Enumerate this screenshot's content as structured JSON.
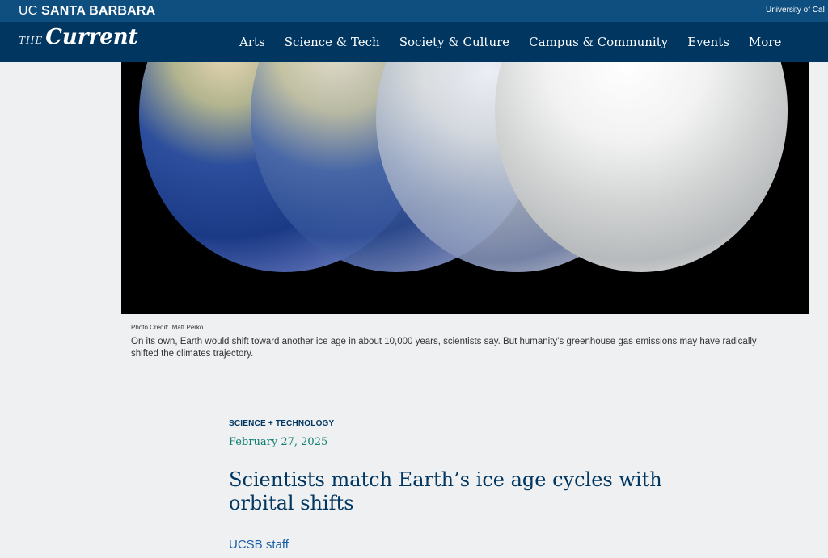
{
  "topbar": {
    "logo_uc": "UC",
    "logo_name": "SANTA BARBARA",
    "right_link": "University of Cal"
  },
  "header": {
    "brand_the": "THE",
    "brand_name": "Current",
    "nav": [
      "Arts",
      "Science & Tech",
      "Society & Culture",
      "Campus & Community",
      "Events",
      "More"
    ]
  },
  "hero": {
    "credit_label": "Photo Credit:",
    "credit_name": "Matt Perko",
    "caption": "On its own, Earth would shift toward another ice age in about 10,000 years, scientists say. But humanity’s greenhouse gas emissions may have radically shifted the climates trajectory."
  },
  "article": {
    "category": "SCIENCE + TECHNOLOGY",
    "date": "February 27, 2025",
    "title": "Scientists match Earth’s ice age cycles with orbital shifts",
    "author": "UCSB staff"
  },
  "colors": {
    "topbar": "#0f4f80",
    "navbar": "#003660",
    "title": "#003660",
    "date": "#0c7f6e",
    "author": "#1a5fa3"
  }
}
